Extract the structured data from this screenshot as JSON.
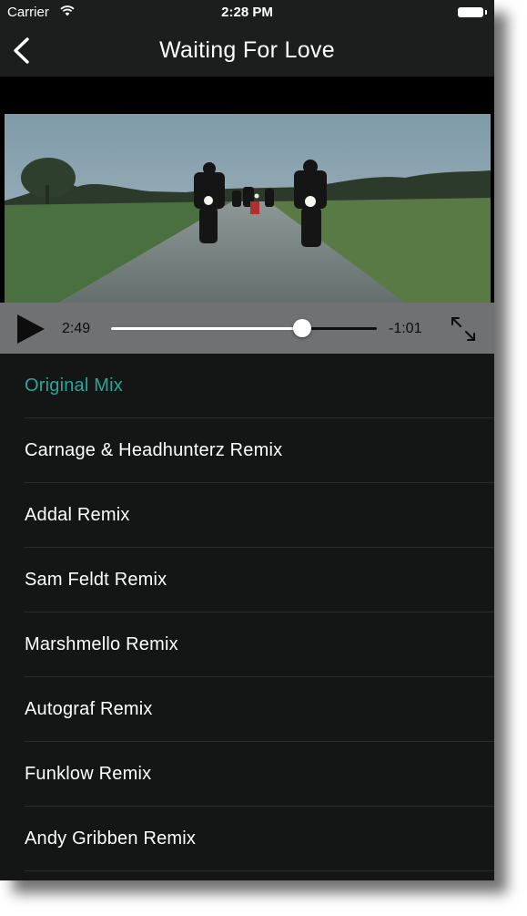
{
  "status_bar": {
    "carrier": "Carrier",
    "time": "2:28 PM",
    "icons": [
      "wifi-icon",
      "battery-icon"
    ]
  },
  "nav": {
    "title": "Waiting For Love",
    "back_icon": "chevron-left-icon"
  },
  "player": {
    "elapsed": "2:49",
    "remaining": "-1:01",
    "progress": 0.72,
    "play_icon": "play-icon",
    "fullscreen_icon": "expand-icon"
  },
  "mixes": [
    {
      "label": "Original Mix",
      "active": true
    },
    {
      "label": "Carnage & Headhunterz Remix",
      "active": false
    },
    {
      "label": "Addal Remix",
      "active": false
    },
    {
      "label": "Sam Feldt Remix",
      "active": false
    },
    {
      "label": "Marshmello Remix",
      "active": false
    },
    {
      "label": "Autograf Remix",
      "active": false
    },
    {
      "label": "Funklow Remix",
      "active": false
    },
    {
      "label": "Andy Gribben Remix",
      "active": false
    }
  ],
  "colors": {
    "accent": "#2aa598",
    "background": "#141616",
    "controls": "#6f7173"
  }
}
